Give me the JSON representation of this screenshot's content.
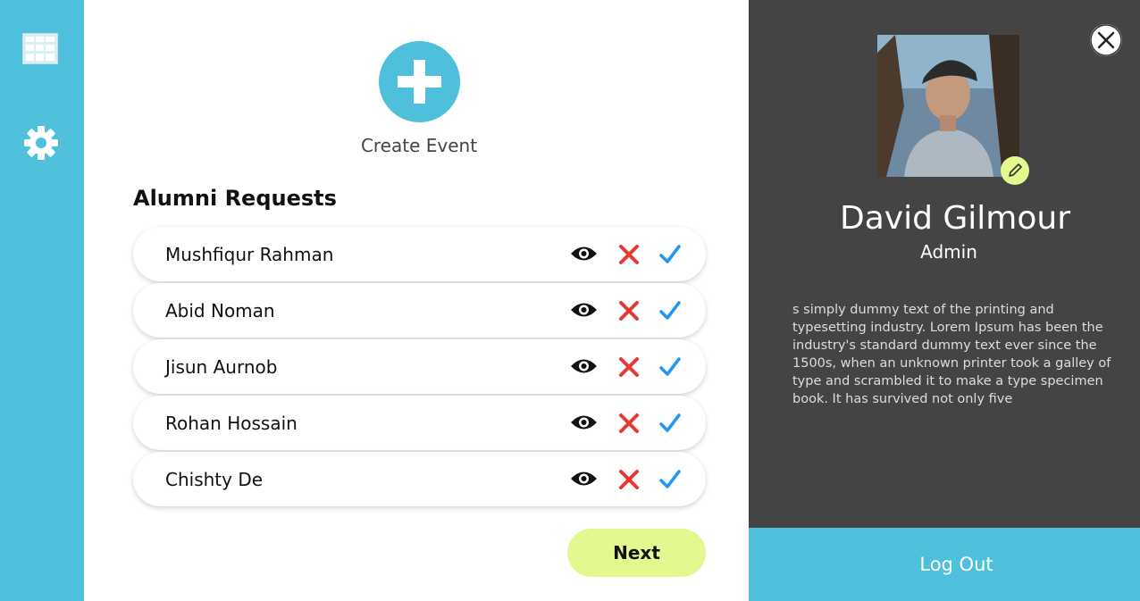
{
  "sidebar": {
    "items": [
      {
        "icon": "dashboard-icon"
      },
      {
        "icon": "gear-icon"
      }
    ]
  },
  "main": {
    "create_event_label": "Create Event",
    "requests_title": "Alumni Requests",
    "requests": [
      {
        "name": "Mushfiqur Rahman"
      },
      {
        "name": "Abid Noman"
      },
      {
        "name": "Jisun Aurnob"
      },
      {
        "name": "Rohan Hossain"
      },
      {
        "name": "Chishty De"
      }
    ],
    "row_actions": [
      "eye-icon",
      "close-icon",
      "check-icon"
    ],
    "next_label": "Next"
  },
  "profile": {
    "name": "David Gilmour",
    "role": "Admin",
    "bio": "s simply dummy text of the printing and typesetting industry. Lorem Ipsum has been the industry's standard dummy text ever since the 1500s, when an unknown printer took a galley of type and scrambled it to make a type specimen book. It has survived not only five",
    "logout_label": "Log Out"
  },
  "colors": {
    "accent": "#4ec0dc",
    "lime": "#e3f88f",
    "panel": "#444444",
    "reject": "#e53935",
    "accept": "#2196f3"
  }
}
